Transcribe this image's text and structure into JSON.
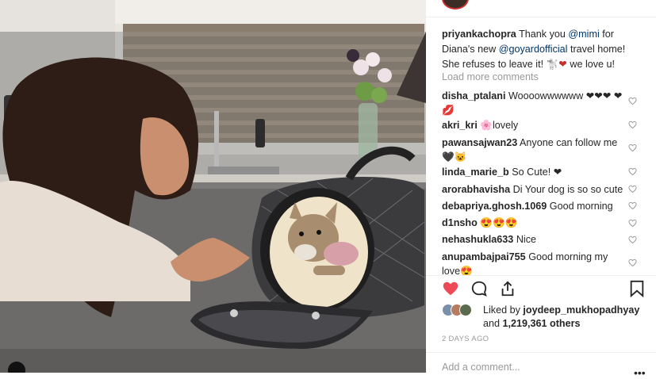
{
  "post": {
    "author": "priyankachopra",
    "caption_part1": "Thank you ",
    "mention1": "@mimi",
    "caption_part2": " for Diana's new ",
    "mention2": "@goyardofficial",
    "caption_part3": " travel home! She refuses to leave it! ",
    "caption_emoji": "🐩",
    "caption_heart": "❤",
    "caption_end": " we love u!"
  },
  "load_more_label": "Load more comments",
  "comments": [
    {
      "user": "disha_ptalani",
      "text": "Woooowwwwww ❤❤❤ ❤💋"
    },
    {
      "user": "akri_kri",
      "text": "🌸lovely"
    },
    {
      "user": "pawansajwan23",
      "text": "Anyone can follow me 🖤😺"
    },
    {
      "user": "linda_marie_b",
      "text": "So Cute! ❤"
    },
    {
      "user": "arorabhavisha",
      "text": "Di Your dog is so so cute"
    },
    {
      "user": "debapriya.ghosh.1069",
      "text": "Good morning"
    },
    {
      "user": "d1nsho",
      "text": "😍😍😍"
    },
    {
      "user": "nehashukla633",
      "text": "Nice"
    },
    {
      "user": "anupambajpai755",
      "text": "Good morning my love😍"
    }
  ],
  "likes": {
    "prefix": "Liked by ",
    "user": "joydeep_mukhopadhyay",
    "middle": "and ",
    "count": "1,219,361 others"
  },
  "timestamp": "2 DAYS AGO",
  "add_comment_placeholder": "Add a comment...",
  "icons": {
    "like": "heart-filled-icon",
    "comment": "speech-bubble-icon",
    "share": "share-icon",
    "save": "bookmark-icon",
    "comment_like": "heart-outline-icon",
    "options": "more-options-icon",
    "photo_info": "info-icon"
  },
  "colors": {
    "like_red": "#ed4956",
    "mention_blue": "#003569",
    "muted_gray": "#999999"
  }
}
